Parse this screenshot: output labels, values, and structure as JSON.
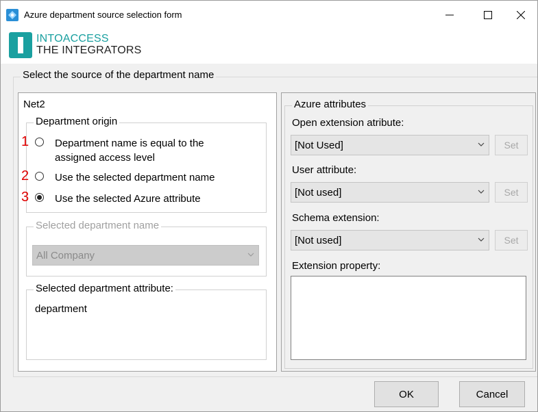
{
  "window": {
    "title": "Azure department source selection form",
    "controls": {
      "minimize": "—",
      "maximize": "☐",
      "close": "✕"
    }
  },
  "logo": {
    "line1": "INTOACCESS",
    "line2": "THE INTEGRATORS",
    "brand_color": "#1aa0a0"
  },
  "main_group": {
    "legend": "Select the source of the department name"
  },
  "net2": {
    "legend": "Net2",
    "department_origin": {
      "legend": "Department origin",
      "options": [
        {
          "number": "1",
          "label_line1": "Department name is equal to the",
          "label_line2": "assigned access level",
          "checked": false
        },
        {
          "number": "2",
          "label_line1": "Use the selected department name",
          "label_line2": "",
          "checked": false
        },
        {
          "number": "3",
          "label_line1": "Use the selected Azure attribute",
          "label_line2": "",
          "checked": true
        }
      ]
    },
    "selected_department_name": {
      "legend": "Selected department name",
      "value": "All Company"
    },
    "selected_department_attribute": {
      "legend": "Selected department attribute:",
      "value": "department"
    }
  },
  "azure": {
    "legend": "Azure attributes",
    "open_extension": {
      "label": "Open extension atribute:",
      "value": "[Not Used]",
      "button": "Set"
    },
    "user_attribute": {
      "label": "User attribute:",
      "value": "[Not used]",
      "button": "Set"
    },
    "schema_extension": {
      "label": "Schema extension:",
      "value": "[Not used]",
      "button": "Set"
    },
    "extension_property": {
      "label": "Extension property:",
      "value": ""
    }
  },
  "footer": {
    "ok": "OK",
    "cancel": "Cancel"
  },
  "colors": {
    "marker_red": "#e00000",
    "window_bg": "#f0f0f0"
  }
}
